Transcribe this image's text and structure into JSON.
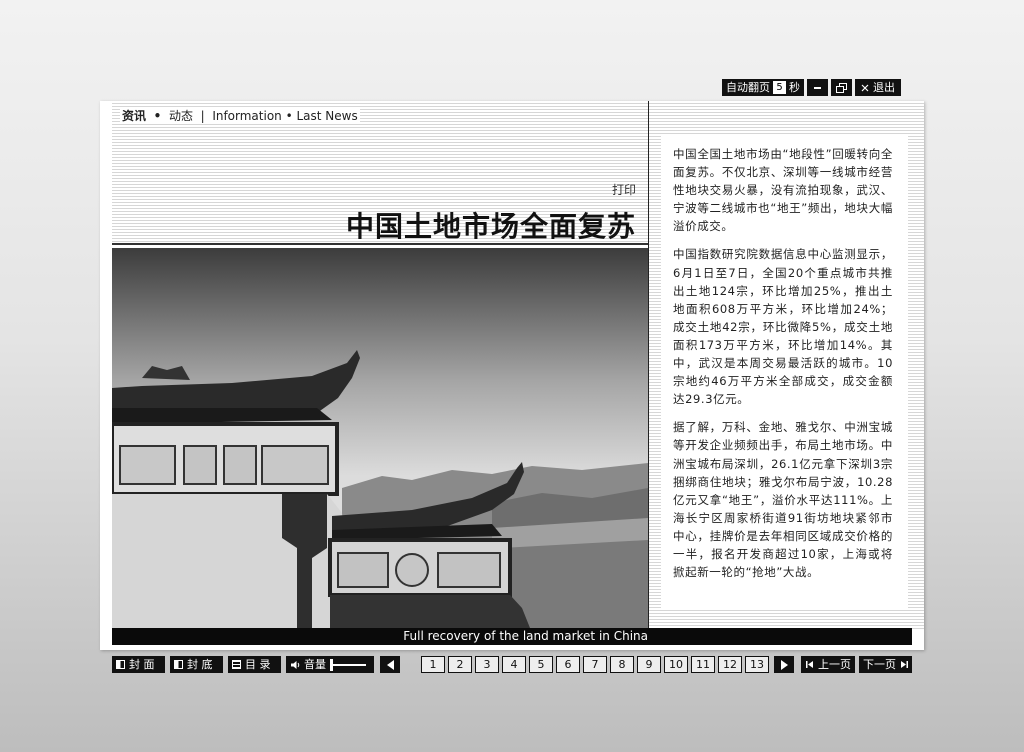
{
  "toolbar": {
    "autoflip_label": "自动翻页",
    "autoflip_seconds": "5",
    "seconds_unit": "秒",
    "exit_label": "退出",
    "exit_icon": "close-x",
    "minimize_icon": "minus",
    "restore_icon": "window-restore"
  },
  "header": {
    "nav_cn_1": "资讯",
    "nav_sep_dot": "•",
    "nav_cn_2": "动态",
    "nav_bar": "|",
    "nav_en": "Information • Last News",
    "print_label": "打印"
  },
  "article": {
    "title": "中国土地市场全面复苏",
    "caption": "Full recovery of the land market in China",
    "paragraphs": [
      "中国全国土地市场由“地段性”回暖转向全面复苏。不仅北京、深圳等一线城市经营性地块交易火暴，没有流拍现象，武汉、宁波等二线城市也“地王”频出，地块大幅溢价成交。",
      "中国指数研究院数据信息中心监测显示，6月1日至7日，全国20个重点城市共推出土地124宗，环比增加25%，推出土地面积608万平方米，环比增加24%；成交土地42宗，环比微降5%，成交土地面积173万平方米，环比增加14%。其中，武汉是本周交易最活跃的城市。10宗地约46万平方米全部成交，成交金额达29.3亿元。",
      "据了解，万科、金地、雅戈尔、中洲宝城等开发企业频频出手，布局土地市场。中洲宝城布局深圳，26.1亿元拿下深圳3宗捆绑商住地块；雅戈尔布局宁波，10.28亿元又拿“地王”，溢价水平达111%。上海长宁区周家桥街道91街坊地块紧邻市中心，挂牌价是去年相同区域成交价格的一半，报名开发商超过10家，上海或将掀起新一轮的“抢地”大战。"
    ]
  },
  "bottom_bar": {
    "front_cover": "封 面",
    "back_cover": "封 底",
    "toc": "目 录",
    "volume": "音量",
    "volume_level": 0.0,
    "pages": [
      "1",
      "2",
      "3",
      "4",
      "5",
      "6",
      "7",
      "8",
      "9",
      "10",
      "11",
      "12",
      "13"
    ],
    "prev_page": "上一页",
    "next_page": "下一页"
  },
  "colors": {
    "toolbar_bg": "#111111",
    "caption_bg": "#0a0a0a"
  }
}
